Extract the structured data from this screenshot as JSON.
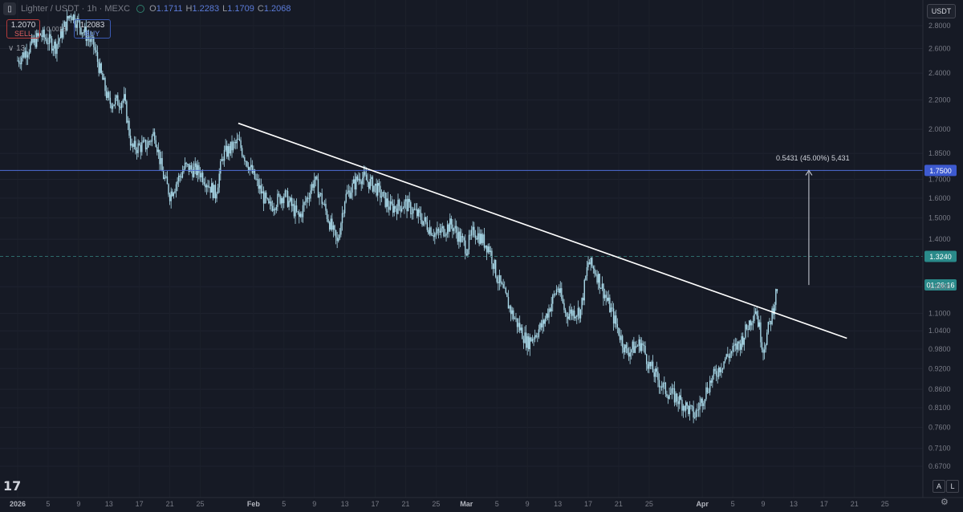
{
  "header": {
    "symbol": "Lighter / USDT · 1h · MEXC",
    "open_label": "O",
    "open": "1.1711",
    "high_label": "H",
    "high": "1.2283",
    "low_label": "L",
    "low": "1.1709",
    "close_label": "C",
    "close": "1.2068"
  },
  "trade": {
    "sell_price": "1.2070",
    "sell_label": "SELL",
    "spread": "0.0013",
    "buy_price": "1.2083",
    "buy_label": "BUY"
  },
  "indicators_count": "13",
  "currency": "USDT",
  "bottom": {
    "auto_label": "A",
    "log_label": "L"
  },
  "colors": {
    "background": "#161a25",
    "candle": "#a8d8e8",
    "trendline": "#ffffff",
    "resistance_line": "#4f6fd9",
    "dashed_line": "#2e6b6b",
    "label_blue": "#3d5ad0",
    "label_teal": "#2a8a8a"
  },
  "icons": [
    "tradingview-logo-icon",
    "gear-icon",
    "chevron-down-icon"
  ],
  "chart_data": {
    "type": "candlestick",
    "symbol": "Lighter / USDT",
    "interval": "1h",
    "exchange": "MEXC",
    "scale": "log",
    "ylim": [
      0.65,
      2.85
    ],
    "y_ticks": [
      "2.8000",
      "2.6000",
      "2.4000",
      "2.2000",
      "2.0000",
      "1.8500",
      "1.7000",
      "1.6000",
      "1.5000",
      "1.4000",
      "1.2000",
      "1.1000",
      "1.0400",
      "0.9800",
      "0.9200",
      "0.8600",
      "0.8100",
      "0.7600",
      "0.7100",
      "0.6700"
    ],
    "x_ticks": [
      {
        "label": "2026",
        "date": "2026-01-01"
      },
      {
        "label": "5",
        "date": "2026-01-05"
      },
      {
        "label": "9",
        "date": "2026-01-09"
      },
      {
        "label": "13",
        "date": "2026-01-13"
      },
      {
        "label": "17",
        "date": "2026-01-17"
      },
      {
        "label": "21",
        "date": "2026-01-21"
      },
      {
        "label": "25",
        "date": "2026-01-25"
      },
      {
        "label": "Feb",
        "date": "2026-02-01"
      },
      {
        "label": "5",
        "date": "2026-02-05"
      },
      {
        "label": "9",
        "date": "2026-02-09"
      },
      {
        "label": "13",
        "date": "2026-02-13"
      },
      {
        "label": "17",
        "date": "2026-02-17"
      },
      {
        "label": "21",
        "date": "2026-02-21"
      },
      {
        "label": "25",
        "date": "2026-02-25"
      },
      {
        "label": "Mar",
        "date": "2026-03-01"
      },
      {
        "label": "5",
        "date": "2026-03-05"
      },
      {
        "label": "9",
        "date": "2026-03-09"
      },
      {
        "label": "13",
        "date": "2026-03-13"
      },
      {
        "label": "17",
        "date": "2026-03-17"
      },
      {
        "label": "21",
        "date": "2026-03-21"
      },
      {
        "label": "25",
        "date": "2026-03-25"
      },
      {
        "label": "Apr",
        "date": "2026-04-01"
      },
      {
        "label": "5",
        "date": "2026-04-05"
      },
      {
        "label": "9",
        "date": "2026-04-09"
      },
      {
        "label": "13",
        "date": "2026-04-13"
      },
      {
        "label": "17",
        "date": "2026-04-17"
      },
      {
        "label": "21",
        "date": "2026-04-21"
      },
      {
        "label": "25",
        "date": "2026-04-25"
      }
    ],
    "price_path": [
      {
        "date": "2026-01-01",
        "price": 2.5
      },
      {
        "date": "2026-01-04",
        "price": 2.72
      },
      {
        "date": "2026-01-06",
        "price": 2.62
      },
      {
        "date": "2026-01-08",
        "price": 2.92
      },
      {
        "date": "2026-01-11",
        "price": 2.62
      },
      {
        "date": "2026-01-12",
        "price": 2.38
      },
      {
        "date": "2026-01-13",
        "price": 2.18
      },
      {
        "date": "2026-01-15",
        "price": 2.2
      },
      {
        "date": "2026-01-16",
        "price": 1.88
      },
      {
        "date": "2026-01-18",
        "price": 1.9
      },
      {
        "date": "2026-01-19",
        "price": 1.98
      },
      {
        "date": "2026-01-20",
        "price": 1.74
      },
      {
        "date": "2026-01-21",
        "price": 1.62
      },
      {
        "date": "2026-01-23",
        "price": 1.77
      },
      {
        "date": "2026-01-25",
        "price": 1.74
      },
      {
        "date": "2026-01-27",
        "price": 1.62
      },
      {
        "date": "2026-01-28",
        "price": 1.84
      },
      {
        "date": "2026-01-30",
        "price": 1.92
      },
      {
        "date": "2026-02-01",
        "price": 1.72
      },
      {
        "date": "2026-02-03",
        "price": 1.55
      },
      {
        "date": "2026-02-05",
        "price": 1.62
      },
      {
        "date": "2026-02-07",
        "price": 1.5
      },
      {
        "date": "2026-02-09",
        "price": 1.7
      },
      {
        "date": "2026-02-11",
        "price": 1.48
      },
      {
        "date": "2026-02-12",
        "price": 1.38
      },
      {
        "date": "2026-02-13",
        "price": 1.6
      },
      {
        "date": "2026-02-15",
        "price": 1.72
      },
      {
        "date": "2026-02-17",
        "price": 1.66
      },
      {
        "date": "2026-02-19",
        "price": 1.55
      },
      {
        "date": "2026-02-21",
        "price": 1.57
      },
      {
        "date": "2026-02-23",
        "price": 1.5
      },
      {
        "date": "2026-02-25",
        "price": 1.42
      },
      {
        "date": "2026-02-27",
        "price": 1.47
      },
      {
        "date": "2026-03-01",
        "price": 1.36
      },
      {
        "date": "2026-03-02",
        "price": 1.44
      },
      {
        "date": "2026-03-04",
        "price": 1.36
      },
      {
        "date": "2026-03-05",
        "price": 1.24
      },
      {
        "date": "2026-03-07",
        "price": 1.1
      },
      {
        "date": "2026-03-09",
        "price": 1.0
      },
      {
        "date": "2026-03-11",
        "price": 1.06
      },
      {
        "date": "2026-03-13",
        "price": 1.2
      },
      {
        "date": "2026-03-14",
        "price": 1.1
      },
      {
        "date": "2026-03-16",
        "price": 1.11
      },
      {
        "date": "2026-03-17",
        "price": 1.3
      },
      {
        "date": "2026-03-18",
        "price": 1.26
      },
      {
        "date": "2026-03-20",
        "price": 1.11
      },
      {
        "date": "2026-03-22",
        "price": 0.97
      },
      {
        "date": "2026-03-24",
        "price": 1.0
      },
      {
        "date": "2026-03-25",
        "price": 0.93
      },
      {
        "date": "2026-03-27",
        "price": 0.86
      },
      {
        "date": "2026-03-29",
        "price": 0.83
      },
      {
        "date": "2026-03-31",
        "price": 0.79
      },
      {
        "date": "2026-04-02",
        "price": 0.88
      },
      {
        "date": "2026-04-04",
        "price": 0.95
      },
      {
        "date": "2026-04-06",
        "price": 1.0
      },
      {
        "date": "2026-04-08",
        "price": 1.12
      },
      {
        "date": "2026-04-09",
        "price": 0.98
      },
      {
        "date": "2026-04-10",
        "price": 1.08
      },
      {
        "date": "2026-04-11",
        "price": 1.22
      }
    ],
    "trendline": {
      "start": {
        "date": "2026-01-30",
        "price": 2.04
      },
      "end": {
        "date": "2026-04-20",
        "price": 1.015
      }
    },
    "horizontal_lines": [
      {
        "price": 1.75,
        "label": "1.7500",
        "style": "solid"
      },
      {
        "price": 1.324,
        "label": "1.3240",
        "style": "dashed"
      }
    ],
    "current_price_label": "1.2070",
    "countdown_label": "01:26:16",
    "measure": {
      "date": "2026-04-15",
      "from": 1.2069,
      "to": 1.75,
      "label": "0.5431 (45.00%) 5,431"
    }
  }
}
